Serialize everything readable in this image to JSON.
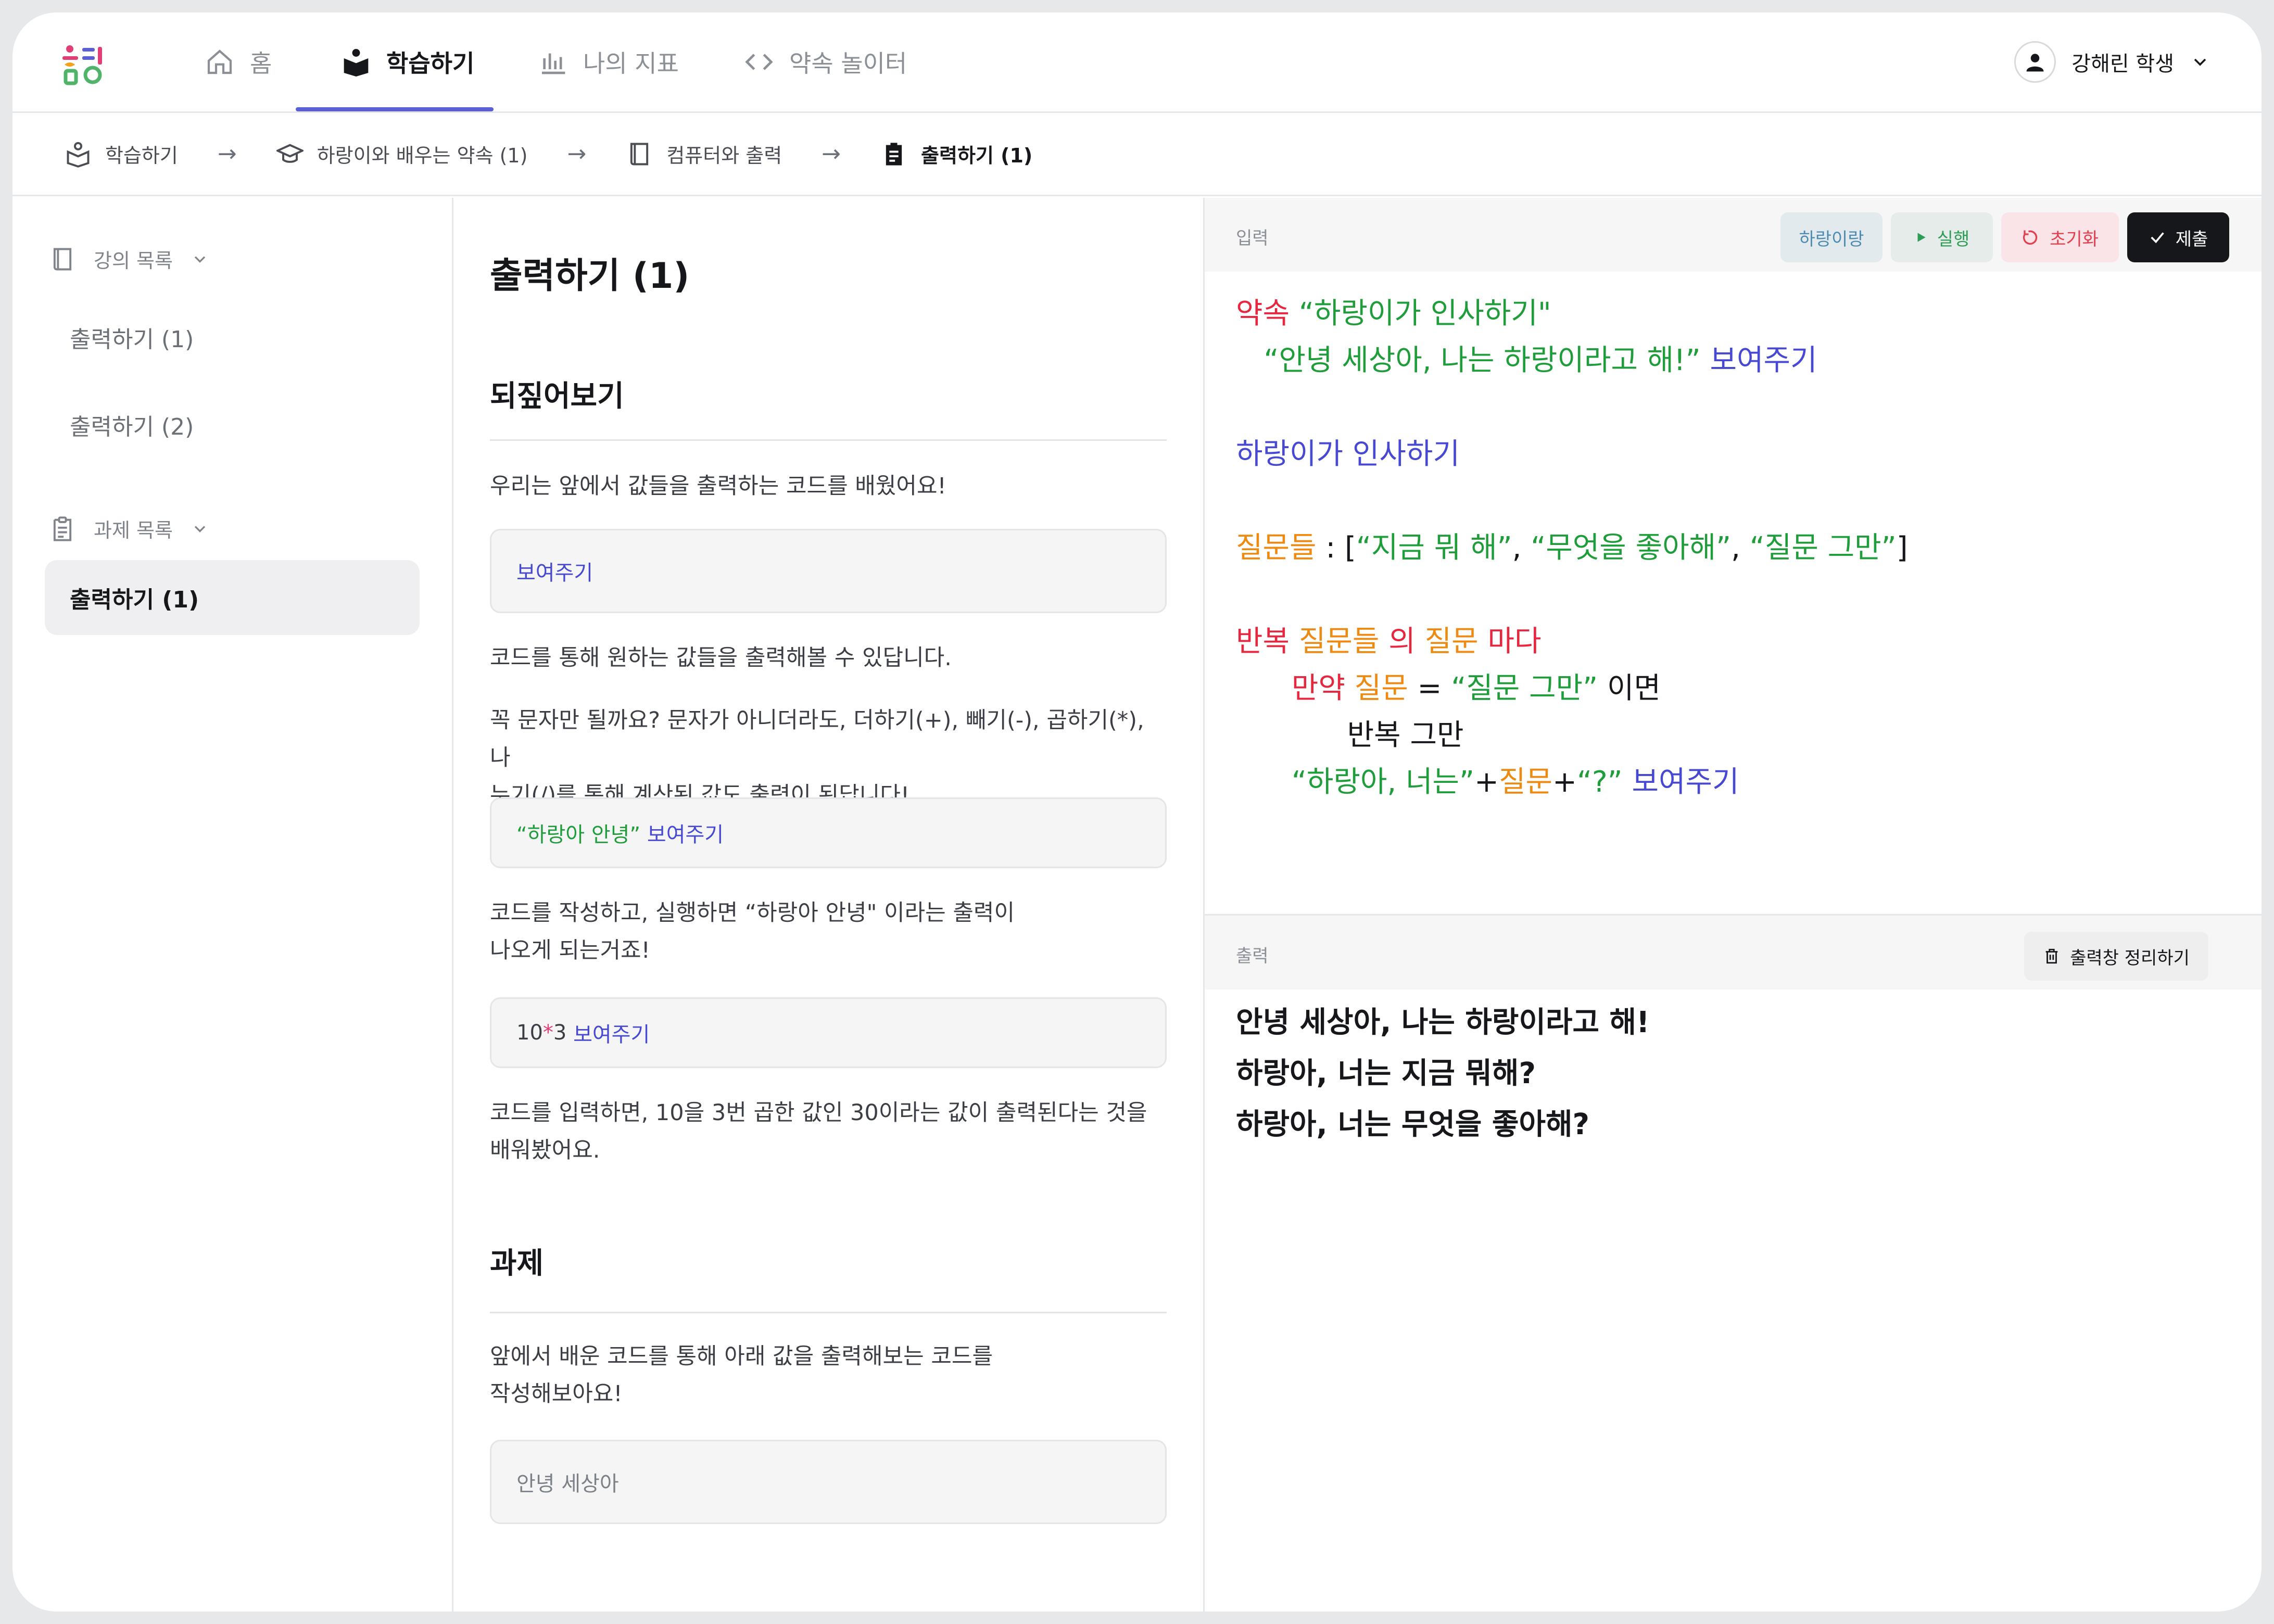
{
  "nav": {
    "tabs": [
      {
        "label": "홈",
        "icon": "home-icon"
      },
      {
        "label": "학습하기",
        "icon": "book-reader-icon",
        "active": true
      },
      {
        "label": "나의 지표",
        "icon": "bar-chart-icon"
      },
      {
        "label": "약속 놀이터",
        "icon": "code-icon"
      }
    ],
    "user": "강해린 학생"
  },
  "breadcrumb": [
    {
      "label": "학습하기",
      "icon": "study-icon"
    },
    {
      "label": "하랑이와 배우는 약속 (1)",
      "icon": "graduation-cap-icon"
    },
    {
      "label": "컴퓨터와 출력",
      "icon": "book-icon"
    },
    {
      "label": "출력하기 (1)",
      "icon": "clipboard-icon"
    }
  ],
  "sidebar": {
    "lectures_header": "강의 목록",
    "lectures": [
      "출력하기 (1)",
      "출력하기 (2)"
    ],
    "tasks_header": "과제 목록",
    "tasks": [
      "출력하기 (1)"
    ]
  },
  "lesson": {
    "title": "출력하기 (1)",
    "review_heading": "되짚어보기",
    "p1": "우리는 앞에서 값들을 출력하는 코드를 배웠어요!",
    "code1": "보여주기",
    "p2": "코드를 통해 원하는 값들을 출력해볼 수 있답니다.",
    "p3_line1": "꼭 문자만 될까요? 문자가 아니더라도, 더하기(+), 빼기(-), 곱하기(*), 나",
    "p3_line2": "누기(/)를 통해 계산된 값도 출력이 된답니다!",
    "code2_string": "“하랑아 안녕”",
    "code2_kw": "보여주기",
    "p4_line1": "코드를 작성하고, 실행하면 “하랑아 안녕\" 이라는 출력이",
    "p4_line2": "나오게 되는거죠!",
    "code3_a": "10",
    "code3_op": "*",
    "code3_b": "3",
    "code3_kw": "보여주기",
    "p5_line1": "코드를 입력하면, 10을 3번 곱한 값인 30이라는 값이 출력된다는 것을",
    "p5_line2": "배워봤어요.",
    "task_heading": "과제",
    "p6_line1": "앞에서 배운 코드를 통해 아래 값을 출력해보는 코드를",
    "p6_line2": "작성해보아요!",
    "task_box": "안녕 세상아"
  },
  "editor": {
    "input_label": "입력",
    "buttons": {
      "harang": "하랑이랑",
      "run": "실행",
      "reset": "초기화",
      "submit": "제출"
    },
    "code": {
      "l1_kw": "약속",
      "l1_str": "“하랑이가 인사하기\"",
      "l2_str": "“안녕 세상아, 나는 하랑이라고 해!”",
      "l2_kw": "보여주기",
      "l4": "하랑이가 인사하기",
      "l6_var": "질문들",
      "l6_colon": " : [",
      "l6_s1": "“지금 뭐 해”",
      "l6_c1": ", ",
      "l6_s2": "“무엇을 좋아해”",
      "l6_c2": ", ",
      "l6_s3": "“질문 그만”",
      "l6_end": "]",
      "l8_kw1": "반복",
      "l8_var1": "질문들",
      "l8_kw2": "의",
      "l8_var2": "질문",
      "l8_kw3": "마다",
      "l9_kw": "만약",
      "l9_var": "질문",
      "l9_eq": " = ",
      "l9_str": "“질문 그만”",
      "l9_tail": " 이면",
      "l10": "반복 그만",
      "l11_s1": "“하랑아, 너는”",
      "l11_p1": "+",
      "l11_var": "질문",
      "l11_p2": "+",
      "l11_s2": "“?”",
      "l11_kw": "보여주기"
    },
    "output_label": "출력",
    "clear_button": "출력창 정리하기",
    "output_lines": [
      "안녕 세상아, 나는 하랑이라고 해!",
      "하랑아, 너는 지금 뭐해?",
      "하랑아, 너는 무엇을 좋아해?"
    ]
  },
  "colors": {
    "accent": "#5b5fd6",
    "keyword_blue": "#4749d2",
    "string_green": "#1f9d3b",
    "keyword_red": "#e5273f",
    "variable_orange": "#ee8a11"
  }
}
